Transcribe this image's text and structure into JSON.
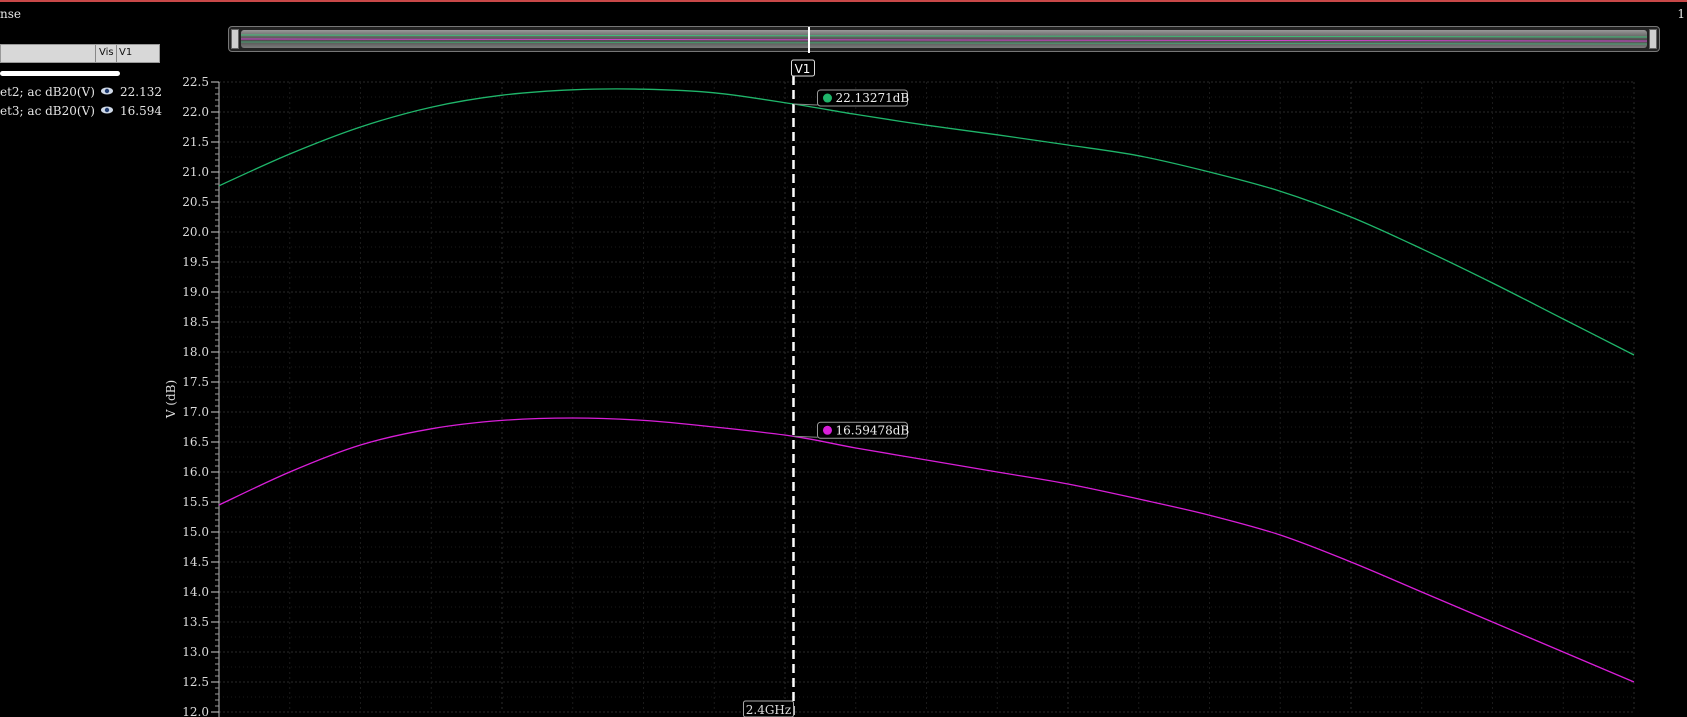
{
  "window": {
    "title": "nse",
    "index": "1"
  },
  "legend": {
    "header": {
      "vis": "Vis",
      "marker": "V1"
    },
    "rows": [
      {
        "label": "et2; ac dB20(V)",
        "value": "22.132",
        "color": "#1fb56a"
      },
      {
        "label": "et3; ac dB20(V)",
        "value": "16.594",
        "color": "#d81ed8"
      }
    ]
  },
  "marker": {
    "name": "V1",
    "x_label": "2.4GHz",
    "readouts": [
      "22.13271dB",
      "16.59478dB"
    ]
  },
  "chart_data": {
    "type": "line",
    "title": "",
    "xlabel": "",
    "ylabel": "V (dB)",
    "ylim": [
      12.0,
      22.5
    ],
    "yticks": [
      "22.5",
      "22.0",
      "21.5",
      "21.0",
      "20.5",
      "20.0",
      "19.5",
      "19.0",
      "18.5",
      "18.0",
      "17.5",
      "17.0",
      "16.5",
      "16.0",
      "15.5",
      "15.0",
      "14.5",
      "14.0",
      "13.5",
      "13.0",
      "12.5",
      "12.0"
    ],
    "xlim": [
      0,
      100
    ],
    "grid": true,
    "legend_position": "left panel",
    "cursor_x": 40.6,
    "x": [
      0,
      5,
      10,
      15,
      20,
      25,
      30,
      35,
      40.6,
      45,
      50,
      55,
      60,
      65,
      70,
      75,
      80,
      85,
      90,
      95,
      100
    ],
    "series": [
      {
        "color": "#1fb56a",
        "values": [
          20.77,
          21.3,
          21.75,
          22.08,
          22.28,
          22.37,
          22.38,
          22.32,
          22.133,
          21.96,
          21.78,
          21.62,
          21.45,
          21.27,
          21.0,
          20.68,
          20.25,
          19.72,
          19.15,
          18.55,
          17.95
        ]
      },
      {
        "color": "#d81ed8",
        "values": [
          15.45,
          16.0,
          16.45,
          16.72,
          16.86,
          16.9,
          16.86,
          16.75,
          16.595,
          16.4,
          16.2,
          16.0,
          15.8,
          15.55,
          15.28,
          14.95,
          14.5,
          14.0,
          13.5,
          13.0,
          12.5
        ]
      }
    ]
  }
}
